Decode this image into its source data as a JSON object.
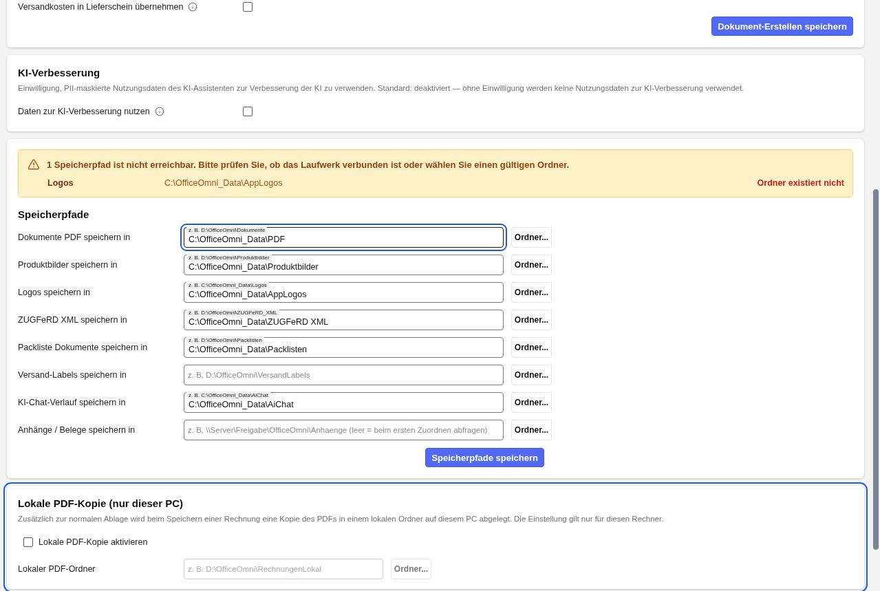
{
  "document_settings": {
    "rows": [
      {
        "label": "Versandkosten in Lieferschein übernehmen",
        "checked": false
      }
    ],
    "save_button": "Dokument-Erstellen speichern"
  },
  "ai_improvement": {
    "title": "KI-Verbesserung",
    "description": "Einwilligung, PII-maskierte Nutzungsdaten des KI-Assistenten zur Verbesserung der KI zu verwenden. Standard: deaktiviert — ohne Einwilligung werden keine Nutzungsdaten zur KI-Verbesserung verwendet.",
    "rows": [
      {
        "label": "Daten zur KI-Verbesserung nutzen",
        "checked": false
      }
    ]
  },
  "storage_paths": {
    "warning": {
      "message": "1 Speicherpfad ist nicht erreichbar. Bitte prüfen Sie, ob das Laufwerk verbunden ist oder wählen Sie einen gültigen Ordner.",
      "items": [
        {
          "name": "Logos",
          "path": "C:\\OfficeOmni_Data\\AppLogos",
          "status": "Ordner existiert nicht"
        }
      ]
    },
    "title": "Speicherpfade",
    "fields": [
      {
        "label": "Dokumente PDF speichern in",
        "placeholder": "z. B. D:\\OfficeOmni\\Dokumente",
        "value": "C:\\OfficeOmni_Data\\PDF",
        "focused": true,
        "button": "Ordner..."
      },
      {
        "label": "Produktbilder speichern in",
        "placeholder": "z. B. D:\\OfficeOmni\\Produktbilder",
        "value": "C:\\OfficeOmni_Data\\Produktbilder",
        "focused": false,
        "button": "Ordner..."
      },
      {
        "label": "Logos speichern in",
        "placeholder": "z. B. C:\\OfficeOmni_Data\\Logos",
        "value": "C:\\OfficeOmni_Data\\AppLogos",
        "focused": false,
        "button": "Ordner..."
      },
      {
        "label": "ZUGFeRD XML speichern in",
        "placeholder": "z. B. D:\\OfficeOmni\\ZUGFeRD_XML",
        "value": "C:\\OfficeOmni_Data\\ZUGFeRD XML",
        "focused": false,
        "button": "Ordner..."
      },
      {
        "label": "Packliste Dokumente speichern in",
        "placeholder": "z. B. D:\\OfficeOmni\\Packlisten",
        "value": "C:\\OfficeOmni_Data\\Packlisten",
        "focused": false,
        "button": "Ordner..."
      },
      {
        "label": "Versand-Labels speichern in",
        "placeholder": "z. B. D:\\OfficeOmni\\VersandLabels",
        "focused": false,
        "button": "Ordner..."
      },
      {
        "label": "KI-Chat-Verlauf speichern in",
        "placeholder": "z. B. C:\\OfficeOmni_Data\\AiChat",
        "value": "C:\\OfficeOmni_Data\\AiChat",
        "focused": false,
        "button": "Ordner..."
      },
      {
        "label": "Anhänge / Belege speichern in",
        "placeholder": "z. B. \\\\Server\\Freigabe\\OfficeOmni\\Anhaenge (leer = beim ersten Zuordnen abfragen)",
        "focused": false,
        "button": "Ordner..."
      }
    ],
    "save_button": "Speicherpfade speichern"
  },
  "local_pdf_copy": {
    "title": "Lokale PDF-Kopie (nur dieser PC)",
    "highlighted": true,
    "description": "Zusätzlich zur normalen Ablage wird beim Speichern einer Rechnung eine Kopie des PDFs in einem lokalen Ordner auf diesem PC abgelegt. Die Einstellung gilt nur für diesen Rechner.",
    "enable": {
      "label": "Lokale PDF-Kopie aktivieren",
      "checked": false
    },
    "folder": {
      "label": "Lokaler PDF-Ordner",
      "placeholder": "z. B. D:\\OfficeOmni\\RechnungenLokal",
      "disabled": true,
      "button": "Ordner..."
    }
  }
}
